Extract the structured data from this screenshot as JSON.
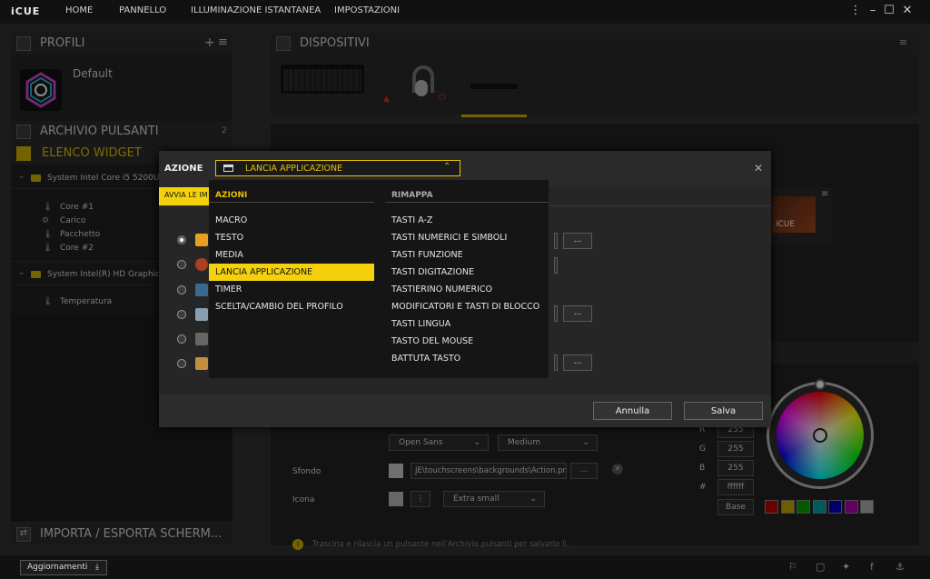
{
  "app": {
    "logo": "iCUE",
    "nav": [
      "HOME",
      "PANNELLO",
      "ILLUMINAZIONE ISTANTANEA",
      "IMPOSTAZIONI"
    ],
    "window_controls": {
      "menu": "⋮",
      "minimize": "–",
      "maximize": "☐",
      "close": "✕"
    }
  },
  "left": {
    "profiles_title": "PROFILI",
    "profile_name": "Default",
    "archive_title": "ARCHIVIO PULSANTI",
    "archive_count": "2",
    "widget_title": "ELENCO WIDGET",
    "groups": [
      {
        "label": "System Intel Core i5 5200U",
        "items": [
          "Core #1",
          "Carico",
          "Pacchetto",
          "Core #2"
        ]
      },
      {
        "label": "System Intel(R) HD Graphics",
        "items": [
          "Temperatura"
        ]
      }
    ],
    "import_export": "IMPORTA / ESPORTA SCHERM..."
  },
  "devices": {
    "title": "DISPOSITIVI"
  },
  "right": {
    "preview_label": "iCUE",
    "font_name": "Open Sans",
    "font_weight": "Medium",
    "sfondo_label": "Sfondo",
    "sfondo_path": "JE\\touchscreens\\backgrounds\\Action.png",
    "browse": "...",
    "icona_label": "Icona",
    "icon_size": "Extra small",
    "hint": "Trascina e rilascia un pulsante nell'Archivio pulsanti per salvarlo lì.",
    "rgb": {
      "r_label": "R",
      "r": "255",
      "g_label": "G",
      "g": "255",
      "b_label": "B",
      "b": "255",
      "hex_label": "#",
      "hex": "ffffff",
      "base": "Base"
    },
    "swatches": [
      "#c00000",
      "#c8a800",
      "#00a000",
      "#00a8a8",
      "#0000c0",
      "#b000b0",
      "#b0b0b0"
    ]
  },
  "dialog": {
    "azione_label": "AZIONE",
    "azione_value": "LANCIA APPLICAZIONE",
    "tab_label": "AVVIA LE IM",
    "azioni_header": "AZIONI",
    "azioni": [
      "MACRO",
      "TESTO",
      "MEDIA",
      "LANCIA APPLICAZIONE",
      "TIMER",
      "SCELTA/CAMBIO DEL PROFILO"
    ],
    "rimappa_header": "RIMAPPA",
    "rimappa": [
      "TASTI A-Z",
      "TASTI NUMERICI E SIMBOLI",
      "TASTI FUNZIONE",
      "TASTI DIGITAZIONE",
      "TASTIERINO NUMERICO",
      "MODIFICATORI E TASTI DI BLOCCO",
      "TASTI LINGUA",
      "TASTO DEL MOUSE",
      "BATTUTA TASTO"
    ],
    "browse": "...",
    "cancel": "Annulla",
    "save": "Salva"
  },
  "status": {
    "updates": "Aggiornamenti"
  }
}
